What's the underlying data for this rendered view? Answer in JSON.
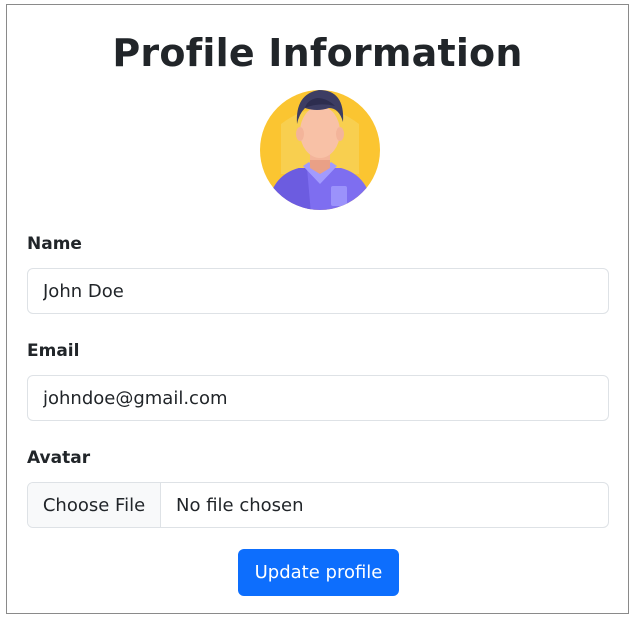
{
  "page": {
    "title": "Profile Information"
  },
  "avatar": {
    "icon": "user-avatar-icon"
  },
  "form": {
    "name_label": "Name",
    "name_value": "John Doe",
    "email_label": "Email",
    "email_value": "johndoe@gmail.com",
    "avatar_label": "Avatar",
    "file_button": "Choose File",
    "file_status": "No file chosen",
    "submit_label": "Update profile"
  },
  "colors": {
    "primary": "#0d6efd",
    "avatar_bg": "#fbc531",
    "shirt": "#7e6ef0"
  }
}
